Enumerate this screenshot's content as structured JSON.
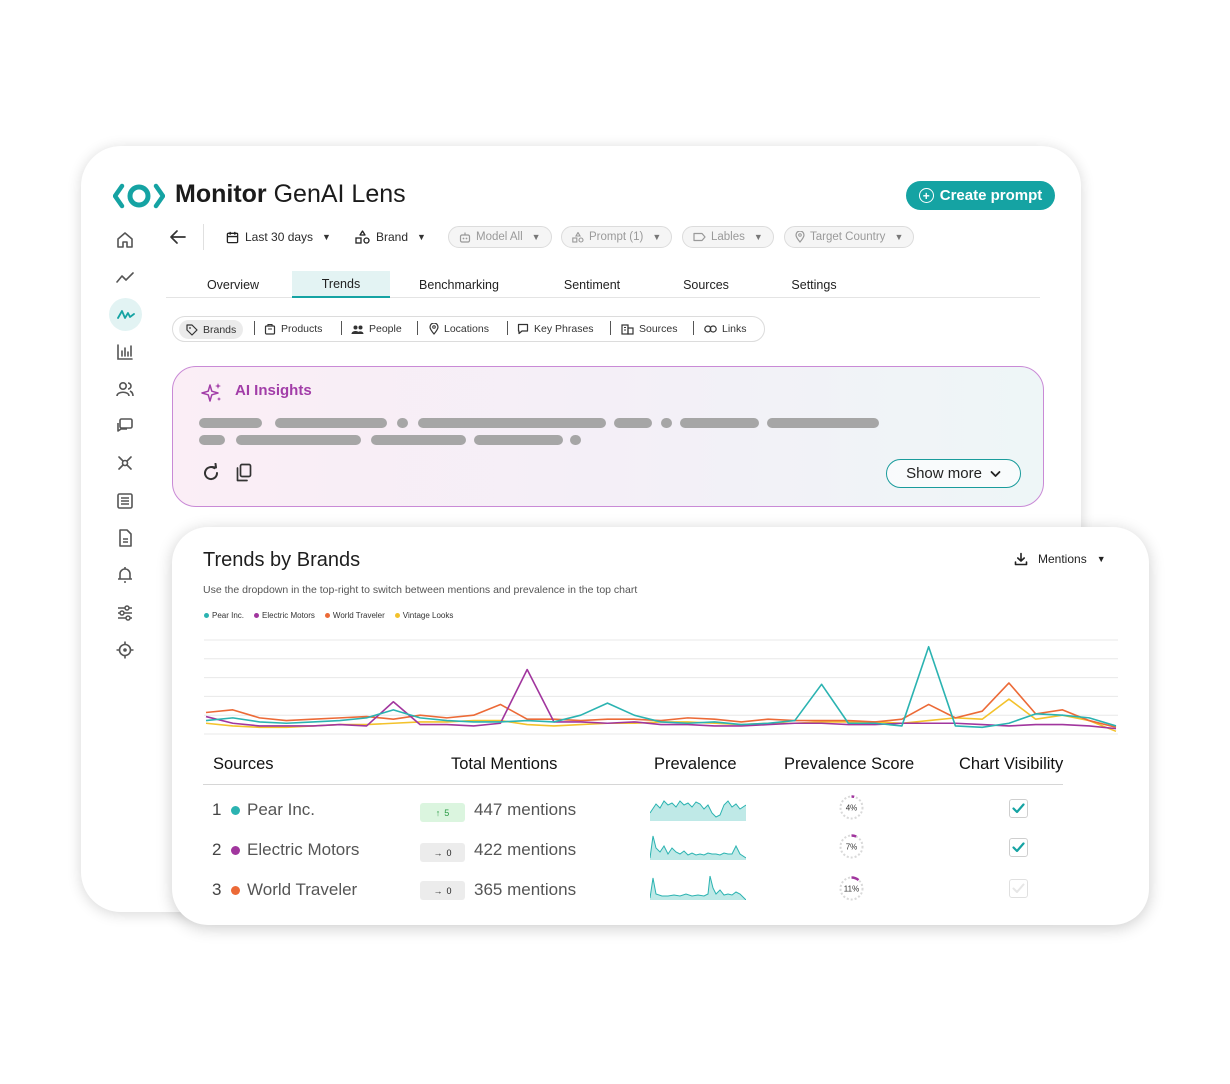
{
  "header": {
    "title_bold": "Monitor",
    "title_rest": "GenAI Lens",
    "create_button": "Create prompt"
  },
  "sidebar": {
    "items": [
      {
        "icon": "home-icon"
      },
      {
        "icon": "trend-line-icon"
      },
      {
        "icon": "activity-icon",
        "active": true
      },
      {
        "icon": "bar-chart-icon"
      },
      {
        "icon": "users-icon"
      },
      {
        "icon": "chat-icon"
      },
      {
        "icon": "network-icon"
      },
      {
        "icon": "list-doc-icon"
      },
      {
        "icon": "document-icon"
      },
      {
        "icon": "bell-icon"
      },
      {
        "icon": "sliders-icon"
      },
      {
        "icon": "gear-icon"
      }
    ]
  },
  "filters": {
    "date": "Last 30 days",
    "brand": "Brand",
    "model": "Model All",
    "prompt": "Prompt (1)",
    "labels": "Lables",
    "country": "Target Country"
  },
  "tabs": [
    "Overview",
    "Trends",
    "Benchmarking",
    "Sentiment",
    "Sources",
    "Settings"
  ],
  "active_tab": "Trends",
  "entities": [
    "Brands",
    "Products",
    "People",
    "Locations",
    "Key Phrases",
    "Sources",
    "Links"
  ],
  "insights": {
    "title": "AI Insights",
    "show_more": "Show more"
  },
  "trends": {
    "title": "Trends by Brands",
    "subtitle": "Use the dropdown in the top-right to switch between mentions and prevalence in the top chart",
    "dropdown": "Mentions"
  },
  "colors": {
    "teal": "#2bb3b1",
    "purple": "#a1369e",
    "orange": "#ec6a37",
    "yellow": "#f3c22c",
    "accent": "#15a3a3"
  },
  "chart_data": {
    "type": "line",
    "legend_placement": "top-left",
    "grid": true,
    "series": [
      {
        "name": "Pear Inc.",
        "color": "#2bb3b1",
        "values": [
          10,
          12,
          9,
          8,
          9,
          10,
          12,
          18,
          12,
          10,
          9,
          9,
          10,
          9,
          14,
          23,
          14,
          9,
          8,
          9,
          7,
          8,
          10,
          37,
          8,
          8,
          6,
          65,
          6,
          5,
          8,
          15,
          14,
          12,
          6
        ]
      },
      {
        "name": "Electric Motors",
        "color": "#a1369e",
        "values": [
          13,
          8,
          6,
          6,
          6,
          7,
          6,
          24,
          7,
          7,
          6,
          8,
          48,
          9,
          9,
          8,
          9,
          7,
          7,
          6,
          6,
          7,
          8,
          8,
          7,
          7,
          8,
          8,
          8,
          7,
          6,
          7,
          7,
          6,
          4
        ]
      },
      {
        "name": "World Traveler",
        "color": "#ec6a37",
        "values": [
          16,
          18,
          12,
          10,
          11,
          12,
          13,
          11,
          14,
          12,
          14,
          22,
          11,
          11,
          10,
          11,
          11,
          10,
          12,
          11,
          9,
          11,
          10,
          10,
          10,
          9,
          11,
          22,
          12,
          17,
          38,
          15,
          18,
          10,
          5
        ]
      },
      {
        "name": "Vintage Looks",
        "color": "#f3c22c",
        "values": [
          8,
          6,
          5,
          5,
          6,
          7,
          7,
          8,
          9,
          9,
          10,
          10,
          7,
          6,
          7,
          8,
          8,
          9,
          9,
          8,
          7,
          8,
          8,
          9,
          9,
          9,
          8,
          10,
          12,
          11,
          26,
          11,
          14,
          10,
          2
        ]
      }
    ]
  },
  "table": {
    "headers": [
      "Sources",
      "Total Mentions",
      "Prevalence",
      "Prevalence Score",
      "Chart Visibility"
    ],
    "rows": [
      {
        "rank": "1",
        "name": "Pear Inc.",
        "delta": "5",
        "delta_dir": "up",
        "mentions": "447 mentions",
        "score": "4%",
        "score_value": 4,
        "visible": true,
        "color": "#2bb3b1"
      },
      {
        "rank": "2",
        "name": "Electric Motors",
        "delta": "0",
        "delta_dir": "flat",
        "mentions": "422 mentions",
        "score": "7%",
        "score_value": 7,
        "visible": true,
        "color": "#a1369e"
      },
      {
        "rank": "3",
        "name": "World Traveler",
        "delta": "0",
        "delta_dir": "flat",
        "mentions": "365 mentions",
        "score": "11%",
        "score_value": 11,
        "visible": false,
        "color": "#ec6a37"
      }
    ]
  }
}
